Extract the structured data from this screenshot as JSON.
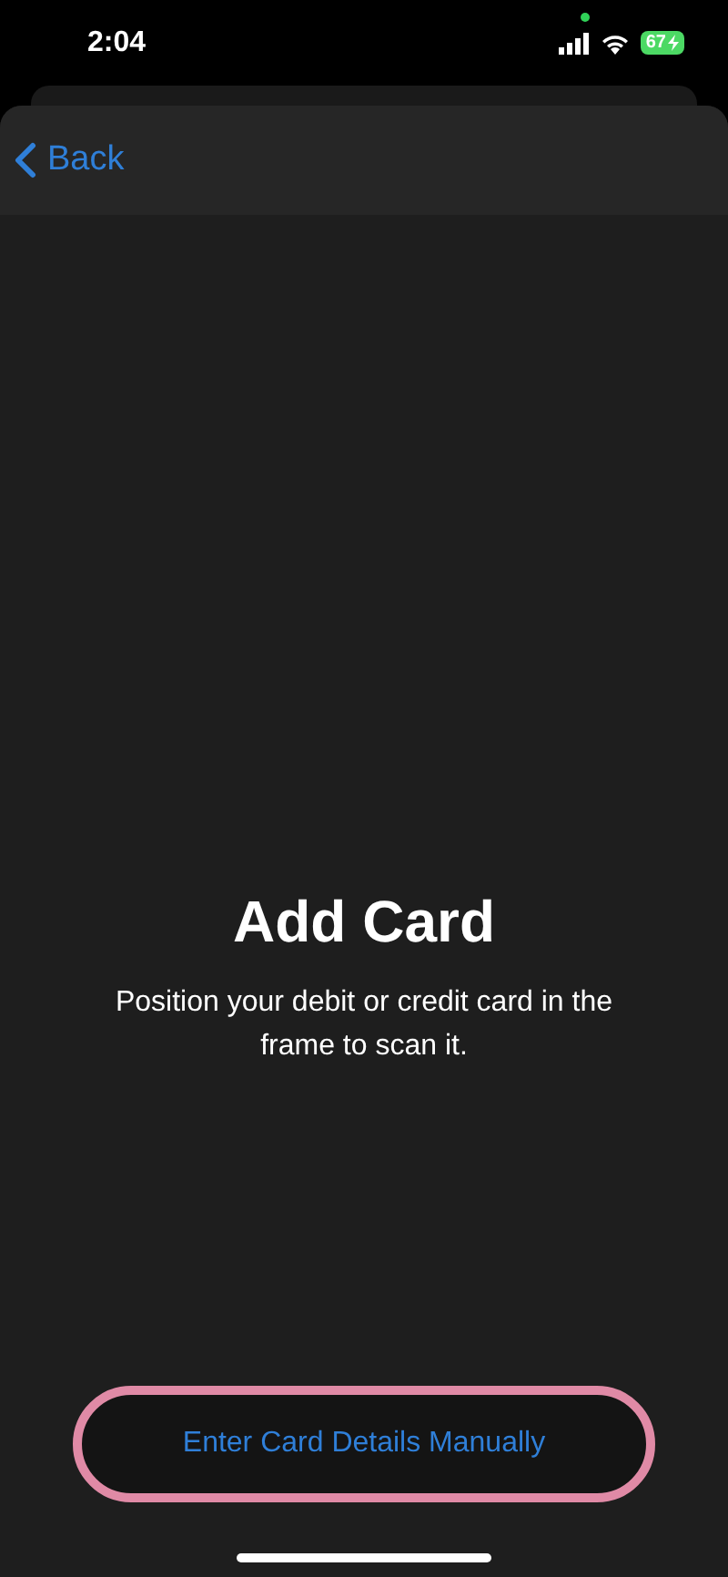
{
  "status_bar": {
    "time": "2:04",
    "battery": "67",
    "charging": true
  },
  "nav": {
    "back": "Back"
  },
  "content": {
    "title": "Add Card",
    "subtitle": "Position your debit or credit card in the frame to scan it."
  },
  "button": {
    "label": "Enter Card Details Manually",
    "highlighted": true
  }
}
